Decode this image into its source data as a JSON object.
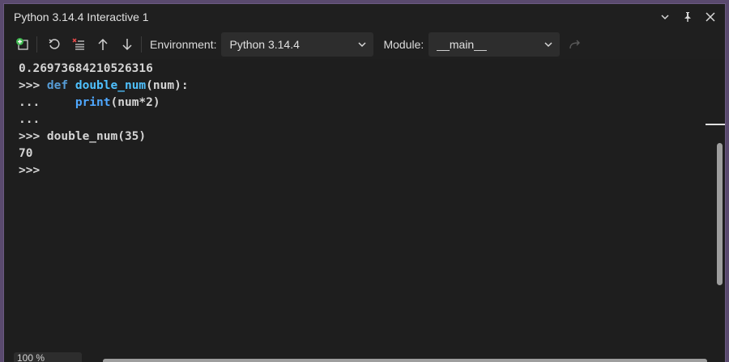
{
  "window": {
    "title": "Python 3.14.4 Interactive 1"
  },
  "toolbar": {
    "environment_label": "Environment:",
    "environment_value": "Python 3.14.4",
    "module_label": "Module:",
    "module_value": "__main__"
  },
  "console": {
    "lines": [
      "0.26973684210526316",
      ">>> def double_num(num):",
      "...     print(num*2)",
      "...",
      ">>> double_num(35)",
      "70",
      ">>>"
    ],
    "l1_prompt": ">>> ",
    "l1_kw": "def",
    "l1_fn": "double_num",
    "l1_rest": "(num):",
    "l2_prompt": "...     ",
    "l2_bi": "print",
    "l2_rest": "(num*2)",
    "l4_prompt": ">>> ",
    "l4_call": "double_num(35)"
  },
  "status": {
    "zoom": "100 %"
  }
}
